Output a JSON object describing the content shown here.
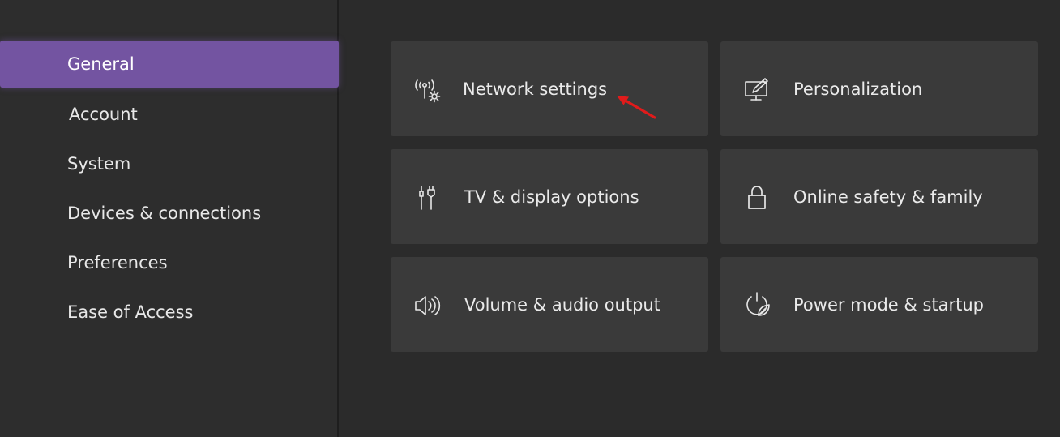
{
  "sidebar": {
    "items": [
      {
        "label": "General",
        "active": true
      },
      {
        "label": "Account",
        "active": false
      },
      {
        "label": "System",
        "active": false
      },
      {
        "label": "Devices & connections",
        "active": false
      },
      {
        "label": "Preferences",
        "active": false
      },
      {
        "label": "Ease of Access",
        "active": false
      }
    ]
  },
  "tiles": [
    {
      "label": "Network settings",
      "icon": "network-settings-icon"
    },
    {
      "label": "Personalization",
      "icon": "personalization-icon"
    },
    {
      "label": "TV & display options",
      "icon": "tv-display-icon"
    },
    {
      "label": "Online safety & family",
      "icon": "lock-icon"
    },
    {
      "label": "Volume & audio output",
      "icon": "speaker-icon"
    },
    {
      "label": "Power mode & startup",
      "icon": "power-leaf-icon"
    }
  ],
  "annotation": {
    "arrow_color": "#e01b1b",
    "icon": "red-arrow-icon"
  },
  "colors": {
    "accent": "#7354a1",
    "tile": "#3a3a3a",
    "background": "#2b2b2b"
  }
}
